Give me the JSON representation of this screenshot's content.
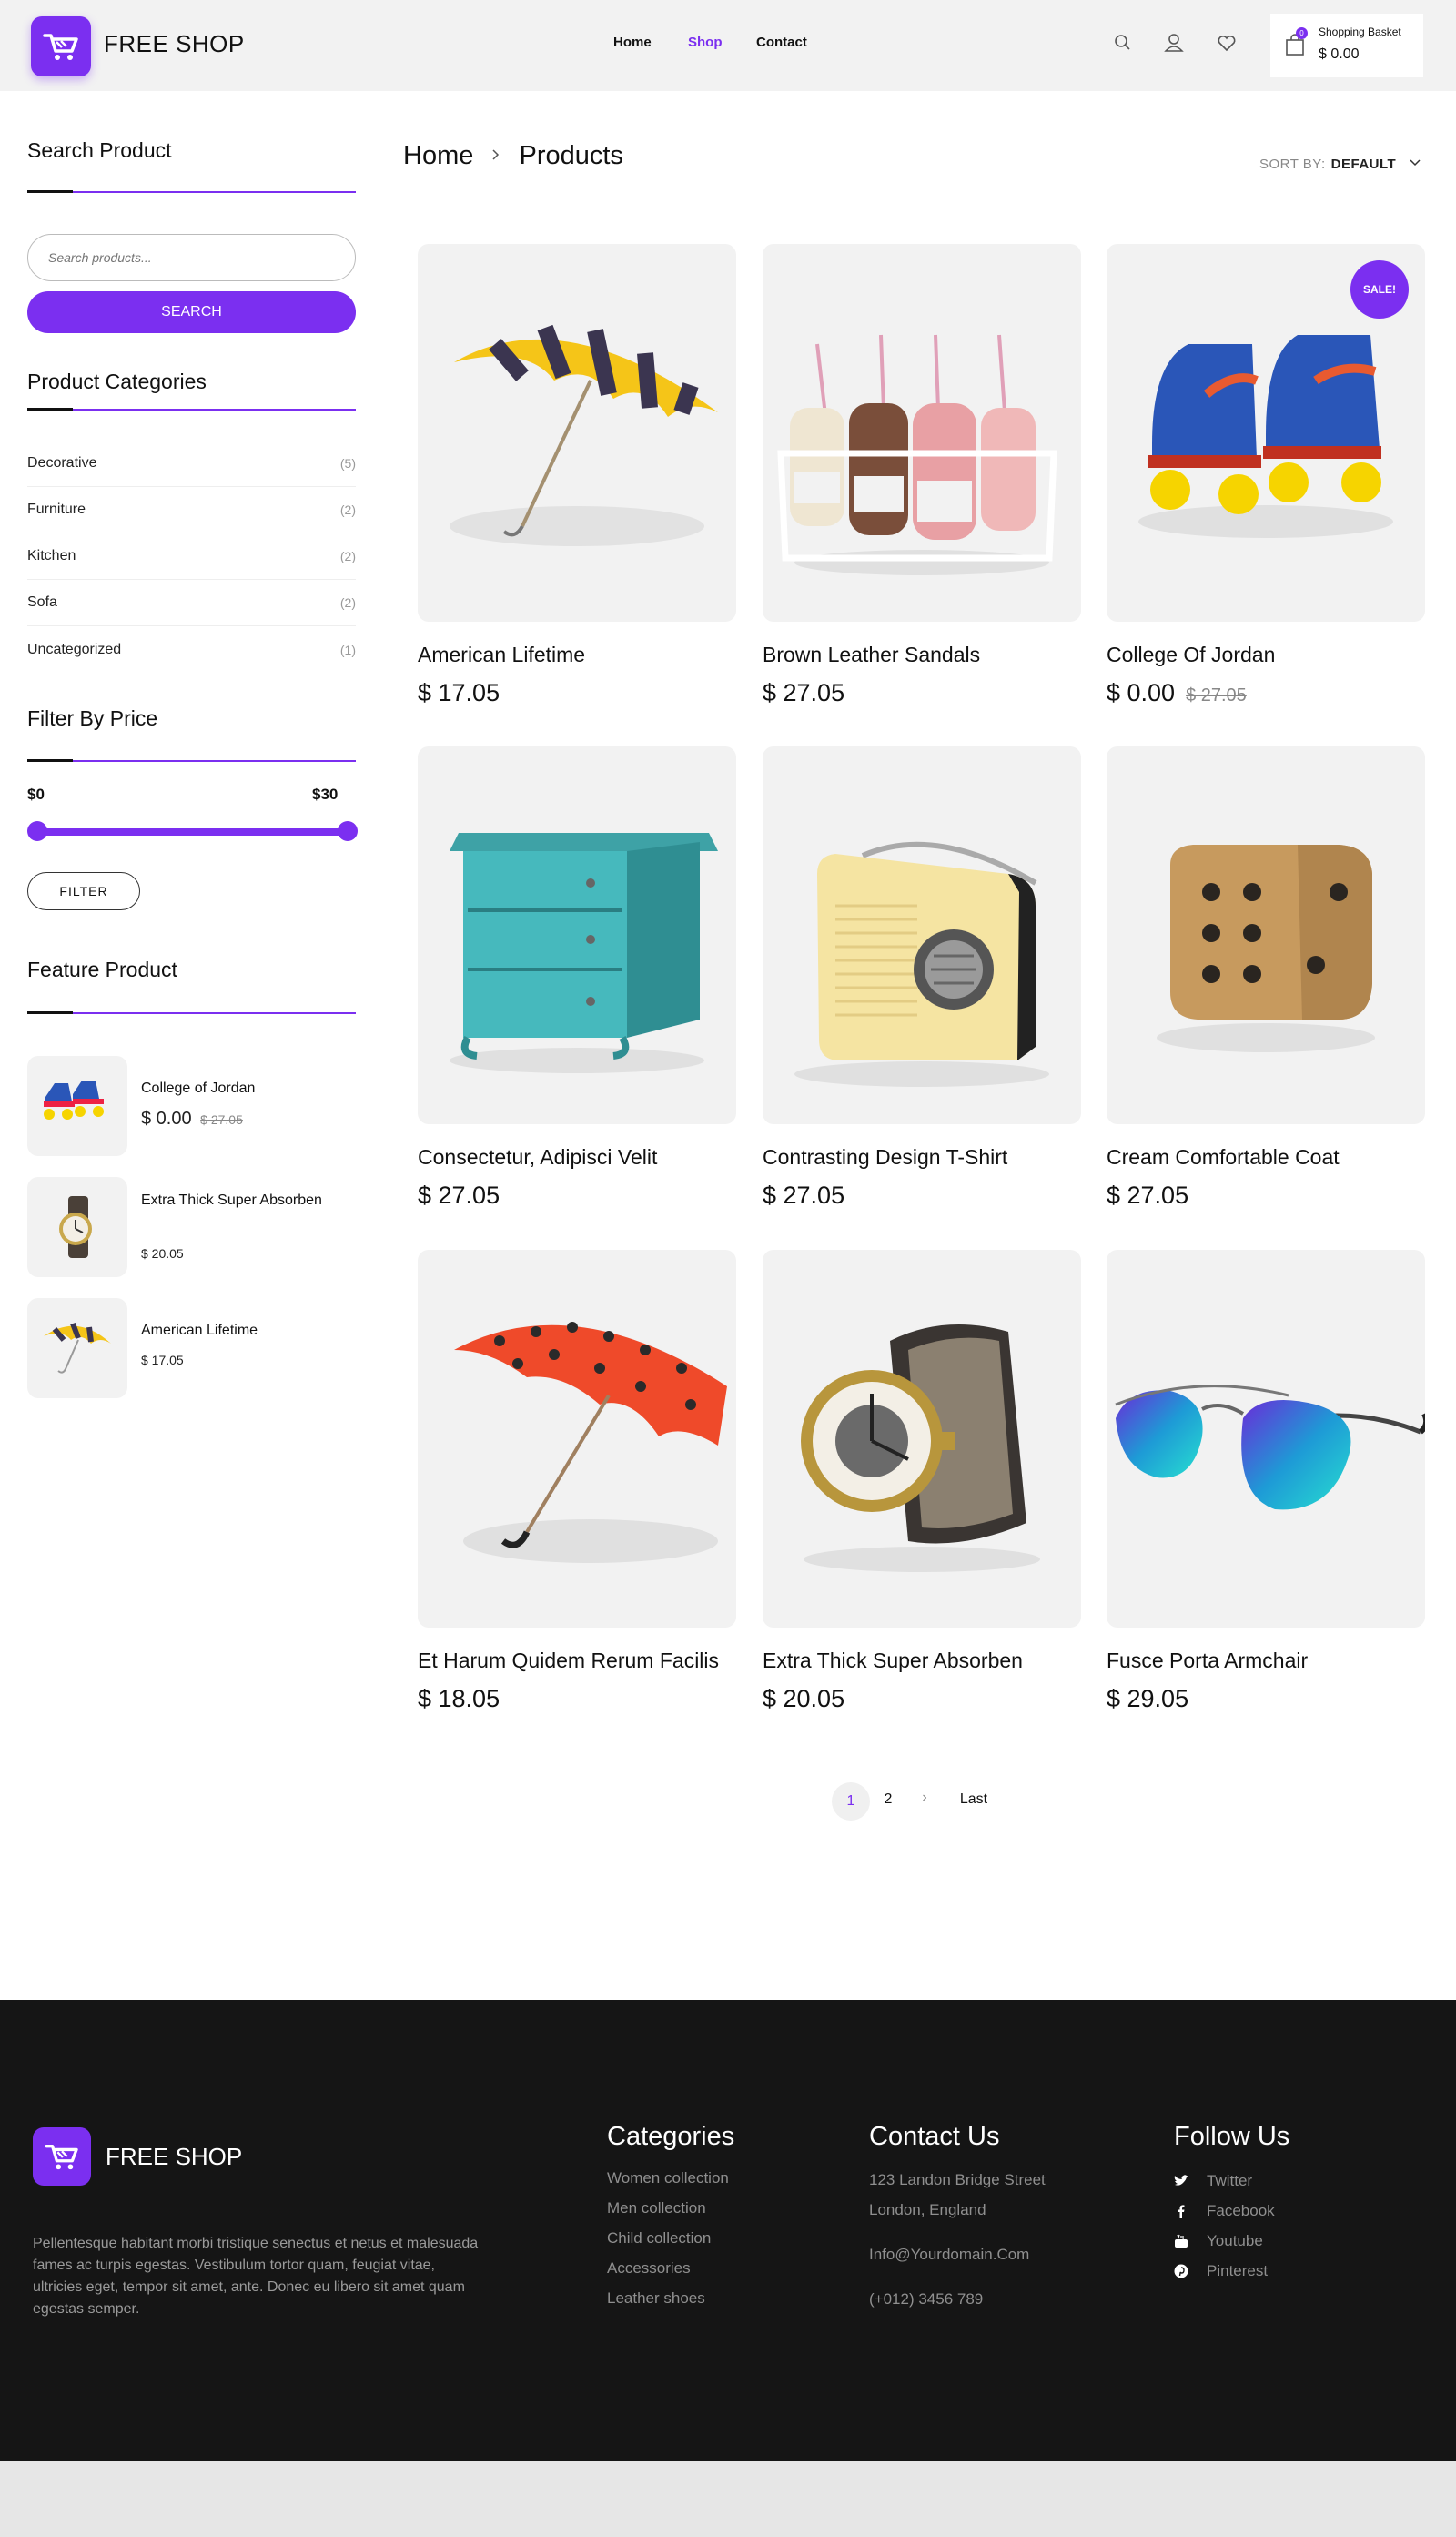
{
  "header": {
    "logo_text": "FREE SHOP",
    "nav": [
      "Home",
      "Shop",
      "Contact"
    ],
    "active_nav": "Shop",
    "basket_count": "0",
    "basket_label": "Shopping Basket",
    "basket_total": "$ 0.00"
  },
  "sidebar": {
    "search_title": "Search Product",
    "search_placeholder": "Search products...",
    "search_button": "SEARCH",
    "categories_title": "Product Categories",
    "categories": [
      {
        "name": "Decorative",
        "count": "(5)"
      },
      {
        "name": "Furniture",
        "count": "(2)"
      },
      {
        "name": "Kitchen",
        "count": "(2)"
      },
      {
        "name": "Sofa",
        "count": "(2)"
      },
      {
        "name": "Uncategorized",
        "count": "(1)"
      }
    ],
    "price_title": "Filter By Price",
    "price_min": "$0",
    "price_max": "$30",
    "filter_button": "FILTER",
    "featured_title": "Feature Product",
    "featured": [
      {
        "name": "College of Jordan",
        "price": "$  0.00",
        "old_price": "$  27.05"
      },
      {
        "name": "Extra Thick Super Absorben",
        "price": "$  20.05"
      },
      {
        "name": "American Lifetime",
        "price": "$  17.05"
      }
    ]
  },
  "main": {
    "breadcrumb": [
      "Home",
      "Products"
    ],
    "sort_label": "SORT BY:",
    "sort_value": "DEFAULT",
    "sale_badge": "SALE!",
    "products": [
      {
        "name": "American Lifetime",
        "price": "$  17.05",
        "image": "yellow-striped-umbrella"
      },
      {
        "name": "Brown Leather Sandals",
        "price": "$  27.05",
        "image": "milk-bottles-crate"
      },
      {
        "name": "College Of Jordan",
        "price": "$  0.00",
        "old_price": "$  27.05",
        "sale": true,
        "image": "roller-skates"
      },
      {
        "name": "Consectetur, Adipisci Velit",
        "price": "$  27.05",
        "image": "teal-dresser"
      },
      {
        "name": "Contrasting Design T-Shirt",
        "price": "$  27.05",
        "image": "retro-radio"
      },
      {
        "name": "Cream Comfortable Coat",
        "price": "$  27.05",
        "image": "wooden-dice"
      },
      {
        "name": "Et Harum Quidem Rerum Facilis",
        "price": "$  18.05",
        "image": "red-polka-umbrella"
      },
      {
        "name": "Extra Thick Super Absorben",
        "price": "$  20.05",
        "image": "wrist-watch"
      },
      {
        "name": "Fusce Porta Armchair",
        "price": "$  29.05",
        "image": "aviator-sunglasses"
      }
    ],
    "pagination": [
      "1",
      "2",
      "›",
      "Last"
    ],
    "current_page": "1"
  },
  "footer": {
    "logo_text": "FREE SHOP",
    "description": "Pellentesque habitant morbi tristique senectus et netus et malesuada fames ac turpis egestas. Vestibulum tortor quam, feugiat vitae, ultricies eget, tempor sit amet, ante. Donec eu libero sit amet quam egestas semper.",
    "categories_title": "Categories",
    "categories": [
      "Women collection",
      "Men collection",
      "Child collection",
      "Accessories",
      "Leather shoes"
    ],
    "contact_title": "Contact Us",
    "address_line1": "123 Landon Bridge Street",
    "address_line2": "London, England",
    "email": "Info@Yourdomain.Com",
    "phone": "(+012) 3456 789",
    "follow_title": "Follow Us",
    "social": [
      "Twitter",
      "Facebook",
      "Youtube",
      "Pinterest"
    ]
  },
  "colors": {
    "accent": "#7b2ff0",
    "footer_bg": "#151515",
    "card_bg": "#f2f2f2"
  }
}
